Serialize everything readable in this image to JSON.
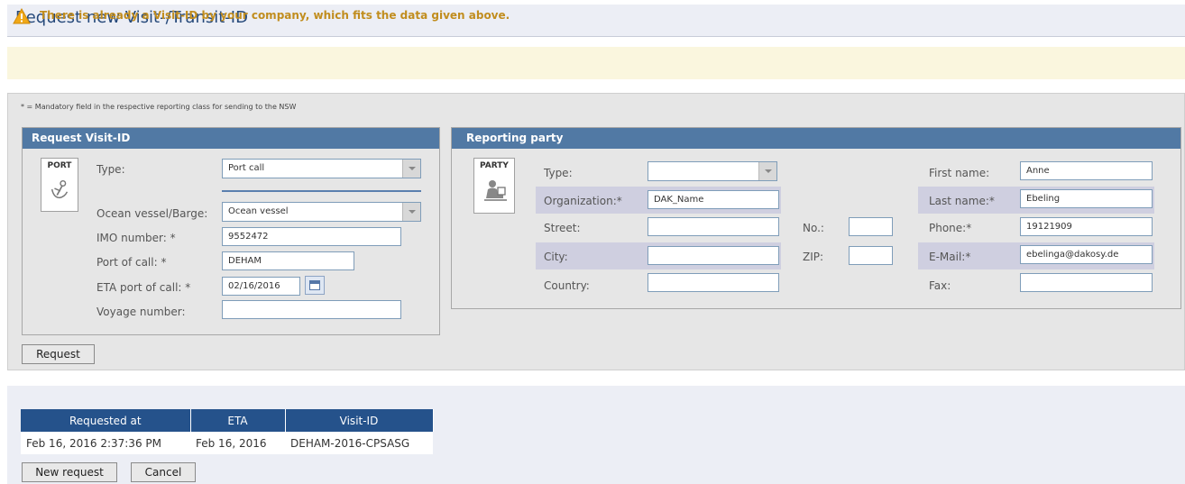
{
  "header": {
    "title": "Request new Visit-/Transit-ID"
  },
  "warning": {
    "icon": "warning-icon",
    "text": "There is already a Visit-ID by your company, which fits the data given above."
  },
  "form": {
    "mandatory_note": "* = Mandatory field in the respective reporting class for sending to the NSW",
    "request_visit": {
      "heading": "Request Visit-ID",
      "icon_label": "PORT",
      "type_label": "Type:",
      "type_value": "Port call",
      "vessel_label": "Ocean vessel/Barge:",
      "vessel_value": "Ocean vessel",
      "imo_label": "IMO number: *",
      "imo_value": "9552472",
      "port_label": "Port of call: *",
      "port_value": "DEHAM",
      "eta_label": "ETA port of call: *",
      "eta_value": "02/16/2016",
      "voyage_label": "Voyage number:",
      "voyage_value": ""
    },
    "reporting_party": {
      "heading": "Reporting party",
      "icon_label": "PARTY",
      "type_label": "Type:",
      "type_value": "",
      "org_label": "Organization:*",
      "org_value": "DAK_Name",
      "street_label": "Street:",
      "street_value": "",
      "no_label": "No.:",
      "no_value": "",
      "city_label": "City:",
      "city_value": "",
      "zip_label": "ZIP:",
      "zip_value": "",
      "country_label": "Country:",
      "country_value": "",
      "first_label": "First name:",
      "first_value": "Anne",
      "last_label": "Last name:*",
      "last_value": "Ebeling",
      "phone_label": "Phone:*",
      "phone_value": "19121909",
      "email_label": "E-Mail:*",
      "email_value": "ebelinga@dakosy.de",
      "fax_label": "Fax:",
      "fax_value": ""
    },
    "request_button": "Request"
  },
  "results": {
    "columns": [
      "Requested at",
      "ETA",
      "Visit-ID"
    ],
    "rows": [
      [
        "Feb 16, 2016 2:37:36 PM",
        "Feb 16, 2016",
        "DEHAM-2016-CPSASG"
      ]
    ],
    "new_request_button": "New request",
    "cancel_button": "Cancel"
  }
}
